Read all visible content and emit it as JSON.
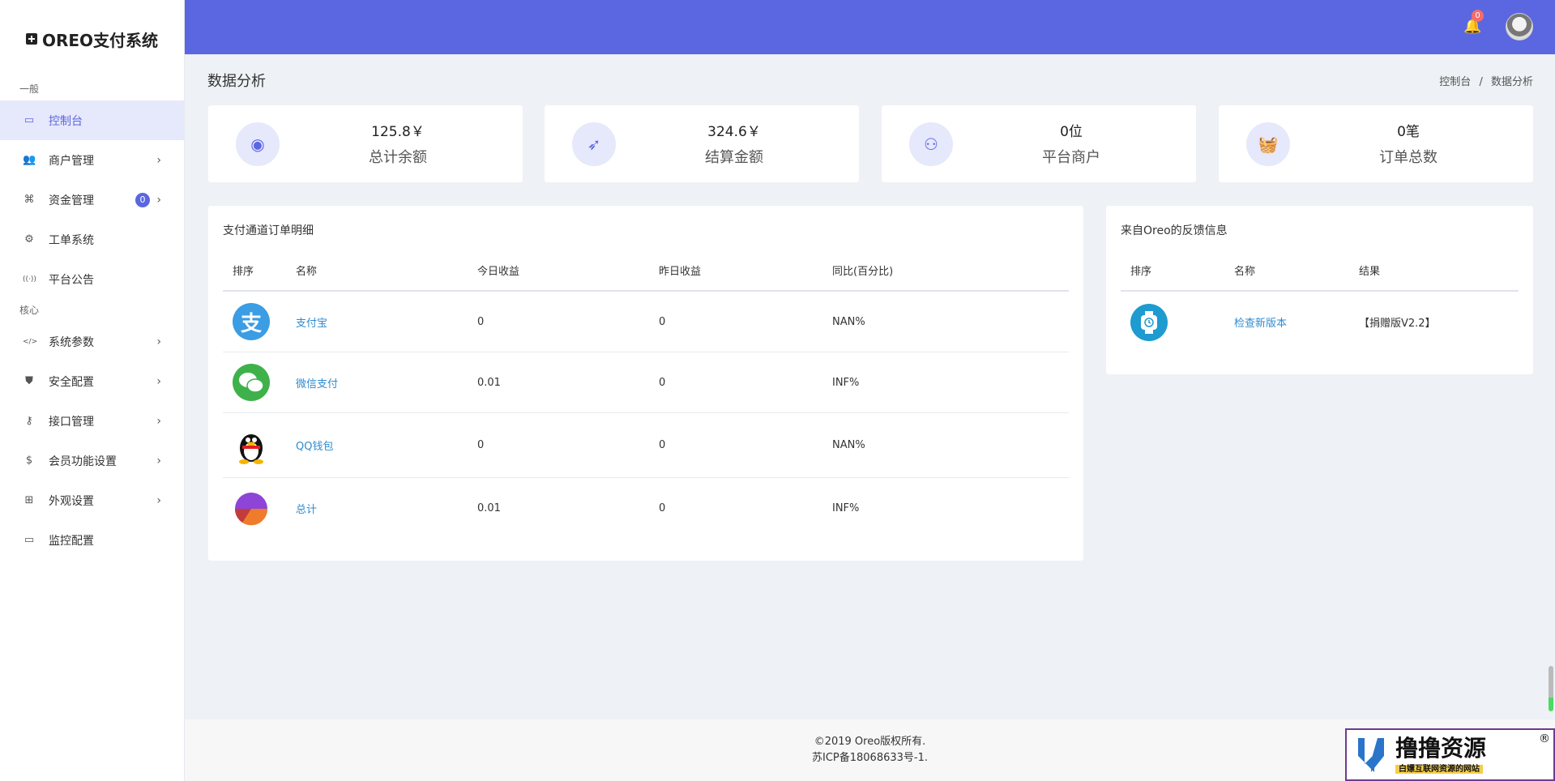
{
  "brand": {
    "title": "OREO支付系统"
  },
  "sidebar": {
    "section_general": "一般",
    "section_core": "核心",
    "items_general": [
      {
        "label": "控制台",
        "icon": "monitor-icon",
        "active": true
      },
      {
        "label": "商户管理",
        "icon": "users-icon",
        "chevron": true
      },
      {
        "label": "资金管理",
        "icon": "command-icon",
        "chevron": true,
        "badge": "0"
      },
      {
        "label": "工单系统",
        "icon": "user-gear-icon"
      },
      {
        "label": "平台公告",
        "icon": "broadcast-icon"
      }
    ],
    "items_core": [
      {
        "label": "系统参数",
        "icon": "code-icon",
        "chevron": true
      },
      {
        "label": "安全配置",
        "icon": "shield-icon",
        "chevron": true
      },
      {
        "label": "接口管理",
        "icon": "key-icon",
        "chevron": true
      },
      {
        "label": "会员功能设置",
        "icon": "dollar-card-icon",
        "chevron": true
      },
      {
        "label": "外观设置",
        "icon": "add-square-icon",
        "chevron": true
      },
      {
        "label": "监控配置",
        "icon": "monitor-icon"
      }
    ]
  },
  "header": {
    "notification_count": "0"
  },
  "page": {
    "title": "数据分析",
    "breadcrumb": [
      "控制台",
      "数据分析"
    ],
    "breadcrumb_sep": "/"
  },
  "stats": [
    {
      "value": "125.8￥",
      "label": "总计余额",
      "icon": "webcam-icon"
    },
    {
      "value": "324.6￥",
      "label": "结算金额",
      "icon": "rocket-icon"
    },
    {
      "value": "0位",
      "label": "平台商户",
      "icon": "users-add-icon"
    },
    {
      "value": "0笔",
      "label": "订单总数",
      "icon": "basket-icon"
    }
  ],
  "channels": {
    "title": "支付通道订单明细",
    "headers": [
      "排序",
      "名称",
      "今日收益",
      "昨日收益",
      "同比(百分比)"
    ],
    "rows": [
      {
        "name": "支付宝",
        "today": "0",
        "yesterday": "0",
        "ratio": "NAN%",
        "icon": "alipay-icon",
        "color": "#3b9de3",
        "glyph": "支"
      },
      {
        "name": "微信支付",
        "today": "0.01",
        "yesterday": "0",
        "ratio": "INF%",
        "icon": "wechat-icon",
        "color": "#3fb14a",
        "glyph": ""
      },
      {
        "name": "QQ钱包",
        "today": "0",
        "yesterday": "0",
        "ratio": "NAN%",
        "icon": "qq-penguin-icon",
        "color": "#111111",
        "glyph": ""
      },
      {
        "name": "总计",
        "today": "0.01",
        "yesterday": "0",
        "ratio": "INF%",
        "icon": "pie-chart-icon",
        "color": "#8e44d6",
        "glyph": ""
      }
    ]
  },
  "feedback": {
    "title": "来自Oreo的反馈信息",
    "headers": [
      "排序",
      "名称",
      "结果"
    ],
    "rows": [
      {
        "name": "检查新版本",
        "result": "【捐赠版V2.2】",
        "icon": "watch-icon",
        "color": "#1e9bd0"
      }
    ]
  },
  "footer": {
    "copyright": "©2019 Oreo版权所有.",
    "icp": "苏ICP备18068633号-1."
  },
  "watermark": {
    "title": "撸撸资源",
    "subtitle": "白嫖互联网资源的网站",
    "reg": "®"
  }
}
